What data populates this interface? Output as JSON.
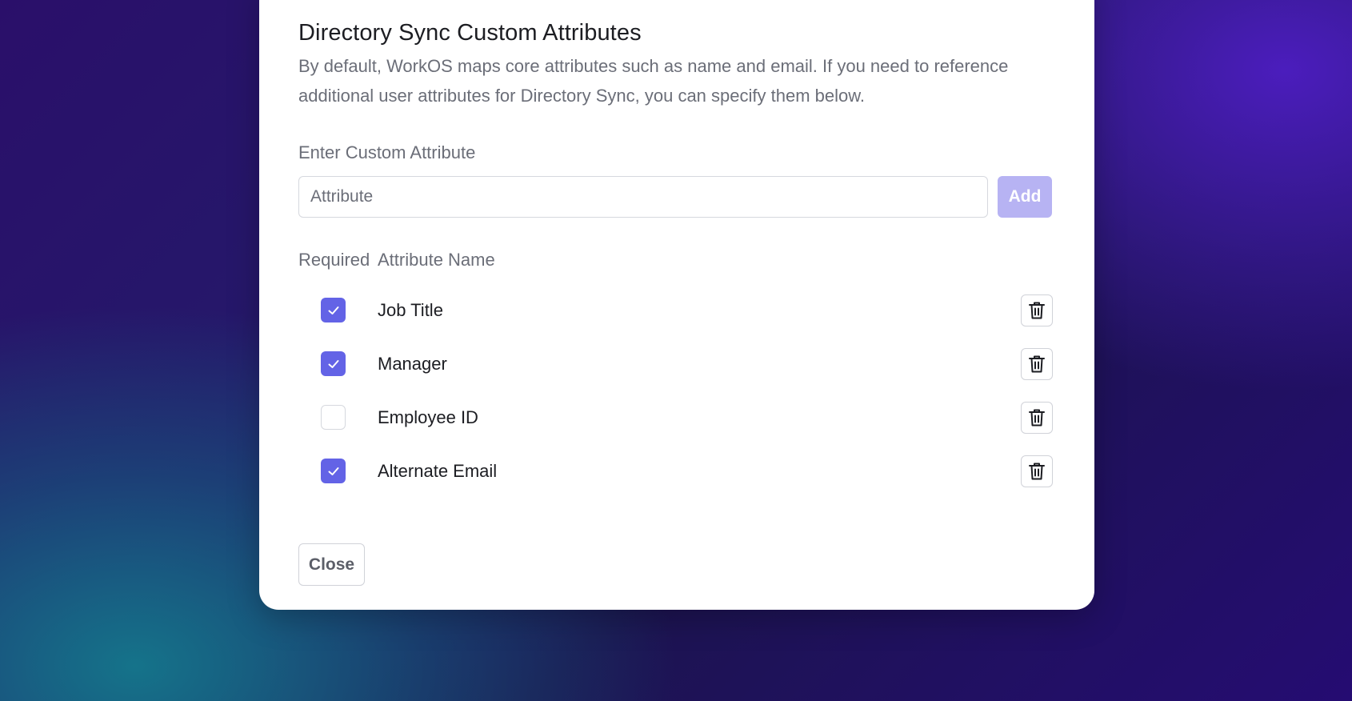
{
  "dialog": {
    "title": "Directory Sync Custom Attributes",
    "description": "By default, WorkOS maps core attributes such as name and email. If you need to reference additional user attributes for Directory Sync, you can specify them below.",
    "field_label": "Enter Custom Attribute",
    "input": {
      "value": "",
      "placeholder": "Attribute"
    },
    "add_label": "Add",
    "columns": {
      "required": "Required",
      "name": "Attribute Name"
    },
    "attributes": [
      {
        "name": "Job Title",
        "required": true
      },
      {
        "name": "Manager",
        "required": true
      },
      {
        "name": "Employee ID",
        "required": false
      },
      {
        "name": "Alternate Email",
        "required": true
      }
    ],
    "close_label": "Close"
  },
  "colors": {
    "accent": "#6363e6",
    "accent_disabled": "#b7b3f3",
    "text_primary": "#1c1d22",
    "text_secondary": "#6b6e78"
  },
  "icons": {
    "checkbox_mark": "check-icon",
    "delete": "trash-icon"
  }
}
